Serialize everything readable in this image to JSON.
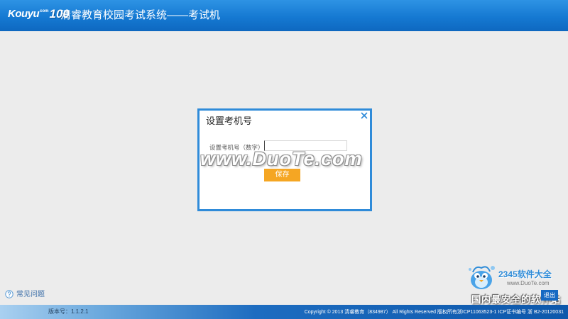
{
  "app": {
    "logo": {
      "brand": "Kouyu",
      "sub": "com",
      "number": "100"
    },
    "title": "清睿教育校园考试系统——考试机"
  },
  "dialog": {
    "title": "设置考机号",
    "close_icon": "close-icon",
    "field_label": "设置考机号（数字）",
    "field_value": "",
    "save_label": "保存"
  },
  "help": {
    "icon": "question-circle-icon",
    "label": "常见问题"
  },
  "exit_label": "退出",
  "footer": {
    "version": "版本号：1.1.2.1",
    "copyright": "Copyright © 2013 清睿教育（834987） All Rights Reserved 版权所有浙ICP11063523-1 ICP证书编号 浙 B2-20120031"
  },
  "watermarks": {
    "center": "www.DuoTe.com",
    "corner_brand": "2345软件大全",
    "corner_url": "www.DuoTe.com",
    "corner_slogan": "国内最安全的软件站"
  },
  "colors": {
    "header": "#1579d2",
    "dialog_border": "#2f8bd9",
    "save_button": "#f5a623",
    "exit_button": "#1669c2",
    "page_background": "#ececec",
    "footer": "#0d58ab"
  }
}
